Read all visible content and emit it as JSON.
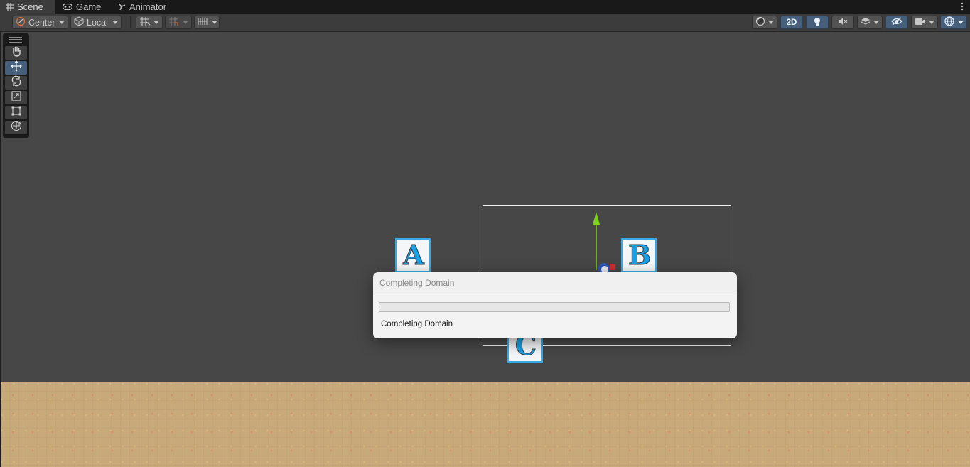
{
  "tabs": [
    {
      "label": "Scene",
      "icon": "grid-icon",
      "active": true
    },
    {
      "label": "Game",
      "icon": "gamepad-icon",
      "active": false
    },
    {
      "label": "Animator",
      "icon": "animator-icon",
      "active": false
    }
  ],
  "toolbar": {
    "pivot_label": "Center",
    "space_label": "Local",
    "mode_2d_label": "2D",
    "pivot_icon": "pivot-icon",
    "space_icon": "cube-icon",
    "grid_snap_icon": "grid-snap-icon",
    "increment_snap_icon": "increment-snap-icon",
    "ruler_icon": "ruler-icon",
    "shading_icon": "shading-sphere-icon",
    "lighting_icon": "light-bulb-icon",
    "audio_icon": "mute-icon",
    "effects_icon": "layers-icon",
    "visibility_icon": "hidden-eye-icon",
    "camera_icon": "camera-icon",
    "gizmos_icon": "gizmo-globe-icon",
    "accent_color": "#46607c"
  },
  "tools": [
    {
      "name": "hand-tool",
      "icon": "hand-icon",
      "selected": false
    },
    {
      "name": "move-tool",
      "icon": "move-arrows-icon",
      "selected": true
    },
    {
      "name": "rotate-tool",
      "icon": "rotate-icon",
      "selected": false
    },
    {
      "name": "scale-tool",
      "icon": "scale-icon",
      "selected": false
    },
    {
      "name": "rect-tool",
      "icon": "rect-transform-icon",
      "selected": false
    },
    {
      "name": "transform-tool",
      "icon": "transform-icon",
      "selected": false
    }
  ],
  "scene": {
    "blocks": [
      {
        "letter": "A",
        "color": "#18a0e6"
      },
      {
        "letter": "B",
        "color": "#18a0e6"
      },
      {
        "letter": "C",
        "color": "#18a0e6"
      }
    ],
    "background_color": "#474747",
    "ground_color": "#c8a97a"
  },
  "dialog": {
    "title": "Completing Domain",
    "status": "Completing Domain",
    "progress": 0
  }
}
